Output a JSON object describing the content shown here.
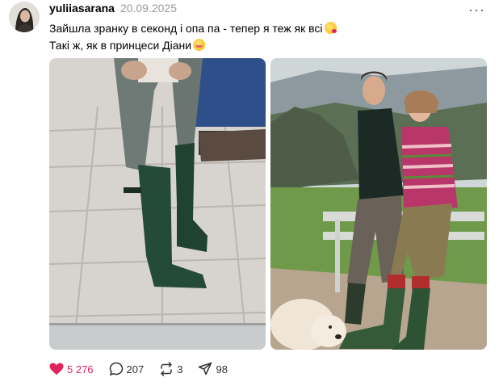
{
  "post": {
    "username": "yuliiasarana",
    "date": "20.09.2025",
    "more_label": "···",
    "text_line1": "Зайшла зранку в секонд і опа па - тепер я теж як всі",
    "text_line2": "Такі ж, як в принцеси Діани",
    "emoji1": "kissing-face-emoji",
    "emoji2": "smiling-face-emoji"
  },
  "images": [
    {
      "name": "green-rain-boots-photo"
    },
    {
      "name": "couple-with-dog-photo"
    }
  ],
  "actions": {
    "likes": "5 276",
    "comments": "207",
    "reposts": "3",
    "shares": "98"
  },
  "colors": {
    "like": "#e0245e",
    "muted": "#999999"
  }
}
